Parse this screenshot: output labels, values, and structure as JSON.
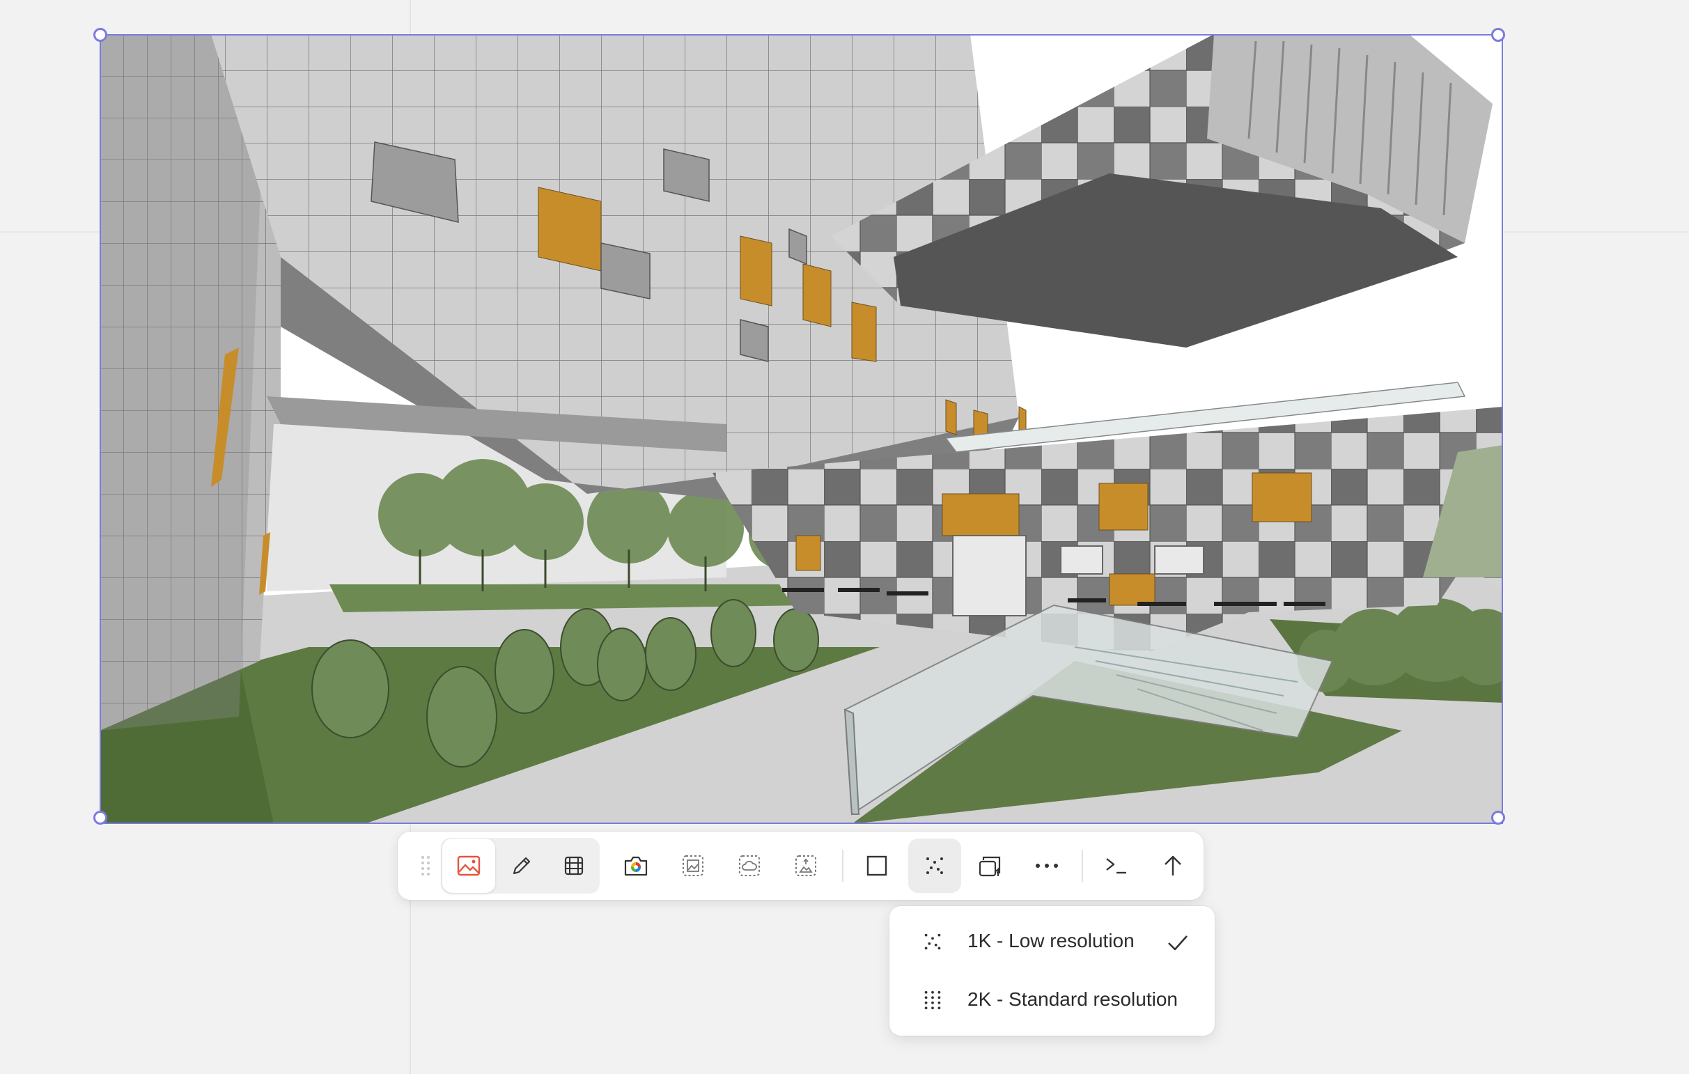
{
  "canvas": {
    "image_description": "architectural rendering of a modern building with courtyard",
    "selection_color": "#7b7bdf"
  },
  "toolbar": {
    "buttons": [
      {
        "name": "drag-handle",
        "icon": "grip-dots-icon"
      },
      {
        "name": "image-mode",
        "icon": "image-icon",
        "active": true
      },
      {
        "name": "sketch-mode",
        "icon": "pencil-icon"
      },
      {
        "name": "video-mode",
        "icon": "film-icon"
      },
      {
        "name": "camera",
        "icon": "camera-icon"
      },
      {
        "name": "landscape-dashed",
        "icon": "landscape-dashed-icon"
      },
      {
        "name": "cloud-dashed",
        "icon": "cloud-dashed-icon"
      },
      {
        "name": "person-dashed",
        "icon": "person-dashed-icon"
      },
      {
        "name": "aspect-ratio",
        "icon": "square-icon"
      },
      {
        "name": "resolution",
        "icon": "sparse-dots-icon",
        "pressed": true
      },
      {
        "name": "variations",
        "icon": "copy-counter-icon"
      },
      {
        "name": "more",
        "icon": "ellipsis-icon"
      },
      {
        "name": "prompt",
        "icon": "terminal-icon"
      },
      {
        "name": "submit",
        "icon": "arrow-up-icon"
      }
    ]
  },
  "resolution_menu": {
    "items": [
      {
        "label": "1K - Low resolution",
        "icon": "sparse-dots-icon",
        "selected": true
      },
      {
        "label": "2K - Standard resolution",
        "icon": "dense-dots-icon",
        "selected": false
      }
    ]
  }
}
